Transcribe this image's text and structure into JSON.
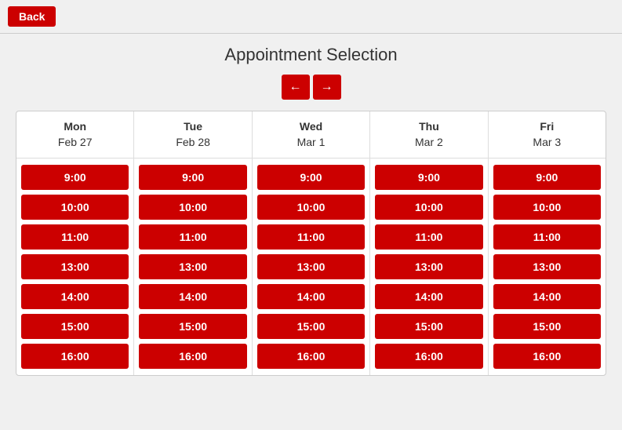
{
  "topBar": {
    "backLabel": "Back"
  },
  "header": {
    "title": "Appointment Selection"
  },
  "navigation": {
    "prevArrow": "←",
    "nextArrow": "→"
  },
  "days": [
    {
      "name": "Mon",
      "date": "Feb 27"
    },
    {
      "name": "Tue",
      "date": "Feb 28"
    },
    {
      "name": "Wed",
      "date": "Mar 1"
    },
    {
      "name": "Thu",
      "date": "Mar 2"
    },
    {
      "name": "Fri",
      "date": "Mar 3"
    }
  ],
  "timeSlots": [
    "9:00",
    "10:00",
    "11:00",
    "13:00",
    "14:00",
    "15:00",
    "16:00"
  ]
}
